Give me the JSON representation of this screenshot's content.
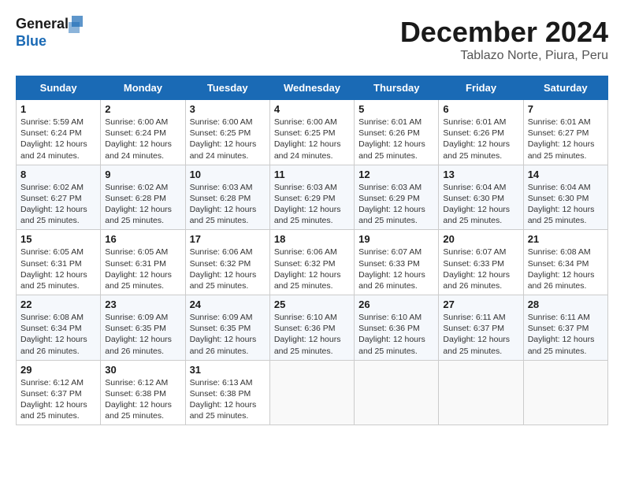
{
  "header": {
    "logo_line1": "General",
    "logo_line2": "Blue",
    "month_title": "December 2024",
    "location": "Tablazo Norte, Piura, Peru"
  },
  "days_of_week": [
    "Sunday",
    "Monday",
    "Tuesday",
    "Wednesday",
    "Thursday",
    "Friday",
    "Saturday"
  ],
  "weeks": [
    [
      {
        "day": "1",
        "info": "Sunrise: 5:59 AM\nSunset: 6:24 PM\nDaylight: 12 hours\nand 24 minutes."
      },
      {
        "day": "2",
        "info": "Sunrise: 6:00 AM\nSunset: 6:24 PM\nDaylight: 12 hours\nand 24 minutes."
      },
      {
        "day": "3",
        "info": "Sunrise: 6:00 AM\nSunset: 6:25 PM\nDaylight: 12 hours\nand 24 minutes."
      },
      {
        "day": "4",
        "info": "Sunrise: 6:00 AM\nSunset: 6:25 PM\nDaylight: 12 hours\nand 24 minutes."
      },
      {
        "day": "5",
        "info": "Sunrise: 6:01 AM\nSunset: 6:26 PM\nDaylight: 12 hours\nand 25 minutes."
      },
      {
        "day": "6",
        "info": "Sunrise: 6:01 AM\nSunset: 6:26 PM\nDaylight: 12 hours\nand 25 minutes."
      },
      {
        "day": "7",
        "info": "Sunrise: 6:01 AM\nSunset: 6:27 PM\nDaylight: 12 hours\nand 25 minutes."
      }
    ],
    [
      {
        "day": "8",
        "info": "Sunrise: 6:02 AM\nSunset: 6:27 PM\nDaylight: 12 hours\nand 25 minutes."
      },
      {
        "day": "9",
        "info": "Sunrise: 6:02 AM\nSunset: 6:28 PM\nDaylight: 12 hours\nand 25 minutes."
      },
      {
        "day": "10",
        "info": "Sunrise: 6:03 AM\nSunset: 6:28 PM\nDaylight: 12 hours\nand 25 minutes."
      },
      {
        "day": "11",
        "info": "Sunrise: 6:03 AM\nSunset: 6:29 PM\nDaylight: 12 hours\nand 25 minutes."
      },
      {
        "day": "12",
        "info": "Sunrise: 6:03 AM\nSunset: 6:29 PM\nDaylight: 12 hours\nand 25 minutes."
      },
      {
        "day": "13",
        "info": "Sunrise: 6:04 AM\nSunset: 6:30 PM\nDaylight: 12 hours\nand 25 minutes."
      },
      {
        "day": "14",
        "info": "Sunrise: 6:04 AM\nSunset: 6:30 PM\nDaylight: 12 hours\nand 25 minutes."
      }
    ],
    [
      {
        "day": "15",
        "info": "Sunrise: 6:05 AM\nSunset: 6:31 PM\nDaylight: 12 hours\nand 25 minutes."
      },
      {
        "day": "16",
        "info": "Sunrise: 6:05 AM\nSunset: 6:31 PM\nDaylight: 12 hours\nand 25 minutes."
      },
      {
        "day": "17",
        "info": "Sunrise: 6:06 AM\nSunset: 6:32 PM\nDaylight: 12 hours\nand 25 minutes."
      },
      {
        "day": "18",
        "info": "Sunrise: 6:06 AM\nSunset: 6:32 PM\nDaylight: 12 hours\nand 25 minutes."
      },
      {
        "day": "19",
        "info": "Sunrise: 6:07 AM\nSunset: 6:33 PM\nDaylight: 12 hours\nand 26 minutes."
      },
      {
        "day": "20",
        "info": "Sunrise: 6:07 AM\nSunset: 6:33 PM\nDaylight: 12 hours\nand 26 minutes."
      },
      {
        "day": "21",
        "info": "Sunrise: 6:08 AM\nSunset: 6:34 PM\nDaylight: 12 hours\nand 26 minutes."
      }
    ],
    [
      {
        "day": "22",
        "info": "Sunrise: 6:08 AM\nSunset: 6:34 PM\nDaylight: 12 hours\nand 26 minutes."
      },
      {
        "day": "23",
        "info": "Sunrise: 6:09 AM\nSunset: 6:35 PM\nDaylight: 12 hours\nand 26 minutes."
      },
      {
        "day": "24",
        "info": "Sunrise: 6:09 AM\nSunset: 6:35 PM\nDaylight: 12 hours\nand 26 minutes."
      },
      {
        "day": "25",
        "info": "Sunrise: 6:10 AM\nSunset: 6:36 PM\nDaylight: 12 hours\nand 25 minutes."
      },
      {
        "day": "26",
        "info": "Sunrise: 6:10 AM\nSunset: 6:36 PM\nDaylight: 12 hours\nand 25 minutes."
      },
      {
        "day": "27",
        "info": "Sunrise: 6:11 AM\nSunset: 6:37 PM\nDaylight: 12 hours\nand 25 minutes."
      },
      {
        "day": "28",
        "info": "Sunrise: 6:11 AM\nSunset: 6:37 PM\nDaylight: 12 hours\nand 25 minutes."
      }
    ],
    [
      {
        "day": "29",
        "info": "Sunrise: 6:12 AM\nSunset: 6:37 PM\nDaylight: 12 hours\nand 25 minutes."
      },
      {
        "day": "30",
        "info": "Sunrise: 6:12 AM\nSunset: 6:38 PM\nDaylight: 12 hours\nand 25 minutes."
      },
      {
        "day": "31",
        "info": "Sunrise: 6:13 AM\nSunset: 6:38 PM\nDaylight: 12 hours\nand 25 minutes."
      },
      {
        "day": "",
        "info": ""
      },
      {
        "day": "",
        "info": ""
      },
      {
        "day": "",
        "info": ""
      },
      {
        "day": "",
        "info": ""
      }
    ]
  ]
}
